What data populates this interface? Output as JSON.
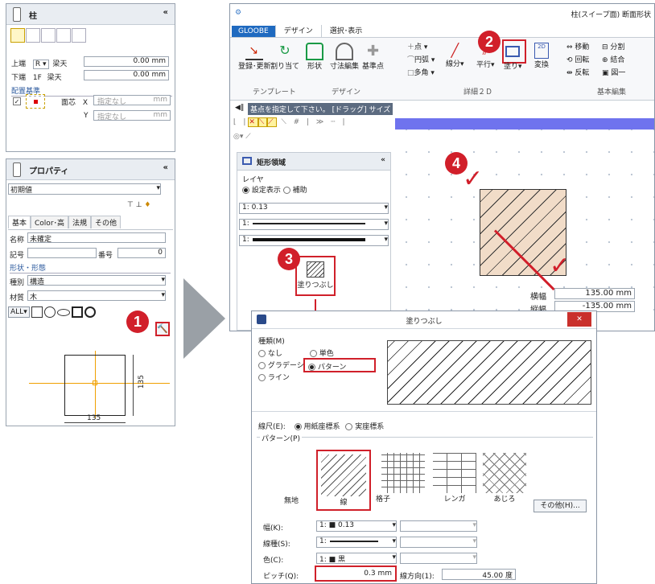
{
  "left": {
    "title": "柱",
    "top_label": "上端",
    "top_level": "R",
    "top_ref": "梁天",
    "top_val": "0.00",
    "unit": "mm",
    "bot_label": "下端",
    "bot_level": "1F",
    "bot_ref": "梁天",
    "bot_val": "0.00",
    "placement_header": "配置基準",
    "face_label": "面芯",
    "x_label": "X",
    "y_label": "Y",
    "unset": "指定なし"
  },
  "prop": {
    "title": "プロパティ",
    "preset": "初期値",
    "tabs": [
      "基本",
      "Color･高",
      "法規",
      "その他"
    ],
    "name_label": "名称",
    "name_val": "未確定",
    "code_label": "記号",
    "num_label": "番号",
    "num_val": "0",
    "shape_header": "形状・形態",
    "type_label": "種別",
    "type_val": "構造",
    "mat_label": "材質",
    "mat_val": "木",
    "all": "ALL",
    "dim_v": "135",
    "dim_h": "135"
  },
  "app": {
    "title": "柱(スイープ面) 断面形状",
    "tabs": [
      "GLOOBE",
      "デザイン",
      "選択･表示"
    ],
    "btn_register": "登録･更新",
    "btn_assign": "割り当て",
    "btn_shape": "形状",
    "btn_dim": "寸法編集",
    "btn_base": "基準点",
    "grp_template": "テンプレート",
    "grp_design": "デザイン",
    "grp_detail": "詳細２Ｄ",
    "grp_basic": "基本編集",
    "d_point": "点",
    "d_arc": "円弧",
    "d_poly": "多角",
    "d_seg": "線分",
    "d_parallel": "平行",
    "d_fill": "塗り",
    "d_convert": "変換",
    "e_move": "移動",
    "e_rotate": "回転",
    "e_flip": "反転",
    "e_split": "分割",
    "e_join": "結合",
    "e_one": "図一",
    "hint": "基点を指定して下さい。 [ドラッグ] サイズ",
    "rect_title": "矩形領域",
    "layer_label": "レイヤ",
    "layer_opt1": "設定表示",
    "layer_opt2": "補助",
    "lw_label": "1: 0.13",
    "lt1": "1:",
    "lt2": "1:",
    "fill_label": "塗りつぶし",
    "width_label": "横幅",
    "width_val": "135.00",
    "height_label": "縦幅",
    "height_val": "-135.00",
    "unit": "mm"
  },
  "dialog": {
    "title": "塗りつぶし",
    "kind_label": "種類(M)",
    "k_none": "なし",
    "k_solid": "単色",
    "k_grad": "グラデーション",
    "k_pattern": "パターン",
    "k_line": "ライン",
    "scale_label": "線尺(E):",
    "scale_opt1": "用紙座標系",
    "scale_opt2": "実座標系",
    "pattern_label": "パターン(P)",
    "patterns": [
      "無地",
      "線",
      "格子",
      "レンガ",
      "あじろ"
    ],
    "other_btn": "その他(H)...",
    "width_label": "幅(K):",
    "width_val": "1: ■ 0.13",
    "ltype_label": "線種(S):",
    "ltype_val": "1:",
    "color_label": "色(C):",
    "color_val": "1: ■ 黒",
    "pitch_label": "ピッチ(Q):",
    "pitch_val": "0.3",
    "pitch_unit": "mm",
    "dir_label": "線方向(1):",
    "dir_val": "45.00",
    "dir_unit": "度"
  },
  "badges": [
    "1",
    "2",
    "3",
    "4"
  ]
}
